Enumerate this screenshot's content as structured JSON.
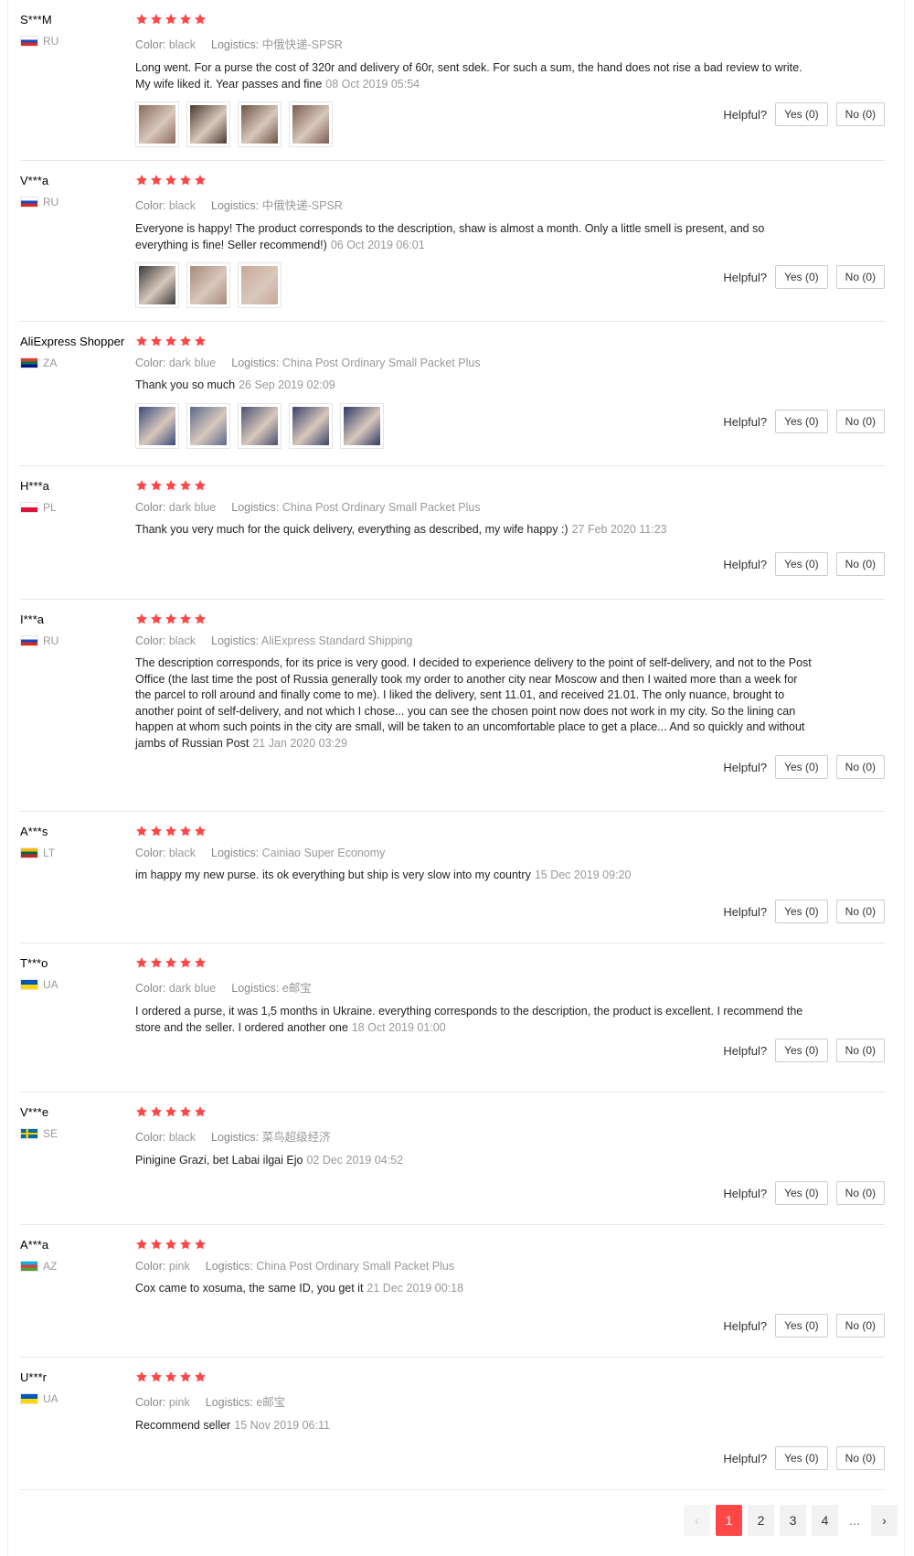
{
  "colors": {
    "star": "#ff4747",
    "accent": "#ff4747"
  },
  "labels": {
    "color": "Color:",
    "logistics": "Logistics:",
    "helpful": "Helpful?"
  },
  "reviews": [
    {
      "user": "S***M",
      "country": "RU",
      "flag": "ru",
      "rating": 5,
      "color": "black",
      "logistics": "中俄快递-SPSR",
      "text": "Long went. For a purse the cost of 320r and delivery of 60r, sent sdek. For such a sum, the hand does not rise a bad review to write. My wife liked it. Year passes and fine",
      "date": "08 Oct 2019 05:54",
      "photos": [
        "#8a6a5c",
        "#4a3a32",
        "#6b5444",
        "#7b5a50"
      ],
      "yes": "Yes (0)",
      "no": "No (0)"
    },
    {
      "user": "V***a",
      "country": "RU",
      "flag": "ru",
      "rating": 5,
      "color": "black",
      "logistics": "中俄快递-SPSR",
      "text": "Everyone is happy! The product corresponds to the description, shaw is almost a month. Only a little smell is present, and so everything is fine! Seller recommend!)",
      "date": "06 Oct 2019 06:01",
      "photos": [
        "#3a3a3a",
        "#a88a7a",
        "#c9a898"
      ],
      "yes": "Yes (0)",
      "no": "No (0)"
    },
    {
      "user": "AliExpress Shopper",
      "country": "ZA",
      "flag": "za",
      "rating": 5,
      "color": "dark blue",
      "logistics": "China Post Ordinary Small Packet Plus",
      "text": "Thank you so much",
      "date": "26 Sep 2019 02:09",
      "photos": [
        "#3b4a7a",
        "#5a6a8a",
        "#4a5070",
        "#3a4468",
        "#2e3a66"
      ],
      "yes": "Yes (0)",
      "no": "No (0)"
    },
    {
      "user": "H***a",
      "country": "PL",
      "flag": "pl",
      "rating": 5,
      "color": "dark blue",
      "logistics": "China Post Ordinary Small Packet Plus",
      "text": "Thank you very much for the quick delivery, everything as described, my wife happy :)",
      "date": "27 Feb 2020 11:23",
      "photos": [],
      "yes": "Yes (0)",
      "no": "No (0)"
    },
    {
      "user": "I***a",
      "country": "RU",
      "flag": "ru",
      "rating": 5,
      "color": "black",
      "logistics": "AliExpress Standard Shipping",
      "text": "The description corresponds, for its price is very good. I decided to experience delivery to the point of self-delivery, and not to the Post Office (the last time the post of Russia generally took my order to another city near Moscow and then I waited more than a week for the parcel to roll around and finally come to me). I liked the delivery, sent 11.01, and received 21.01. The only nuance, brought to another point of self-delivery, and not which I chose... you can see the chosen point now does not work in my city. So the lining can happen at whom such points in the city are small, will be taken to an uncomfortable place to get a place... And so quickly and without jambs of Russian Post",
      "date": "21 Jan 2020 03:29",
      "photos": [],
      "yes": "Yes (0)",
      "no": "No (0)"
    },
    {
      "user": "A***s",
      "country": "LT",
      "flag": "lt",
      "rating": 5,
      "color": "black",
      "logistics": "Cainiao Super Economy",
      "text": "im happy my new purse. its ok everything but ship is very slow into my country",
      "date": "15 Dec 2019 09:20",
      "photos": [],
      "yes": "Yes (0)",
      "no": "No (0)"
    },
    {
      "user": "T***o",
      "country": "UA",
      "flag": "ua",
      "rating": 5,
      "color": "dark blue",
      "logistics": "e邮宝",
      "text": "I ordered a purse, it was 1,5 months in Ukraine. everything corresponds to the description, the product is excellent. I recommend the store and the seller. I ordered another one",
      "date": "18 Oct 2019 01:00",
      "photos": [],
      "yes": "Yes (0)",
      "no": "No (0)"
    },
    {
      "user": "V***e",
      "country": "SE",
      "flag": "se",
      "rating": 5,
      "color": "black",
      "logistics": "菜鸟超级经济",
      "text": "Pinigine Grazi, bet Labai ilgai Ejo",
      "date": "02 Dec 2019 04:52",
      "photos": [],
      "yes": "Yes (0)",
      "no": "No (0)"
    },
    {
      "user": "A***a",
      "country": "AZ",
      "flag": "az",
      "rating": 5,
      "color": "pink",
      "logistics": "China Post Ordinary Small Packet Plus",
      "text": "Cox came to xosuma, the same ID, you get it",
      "date": "21 Dec 2019 00:18",
      "photos": [],
      "yes": "Yes (0)",
      "no": "No (0)"
    },
    {
      "user": "U***r",
      "country": "UA",
      "flag": "ua",
      "rating": 5,
      "color": "pink",
      "logistics": "e邮宝",
      "text": "Recommend seller",
      "date": "15 Nov 2019 06:11",
      "photos": [],
      "yes": "Yes (0)",
      "no": "No (0)"
    }
  ],
  "pagination": {
    "prev_icon": "chevron-left-icon",
    "next_icon": "chevron-right-icon",
    "pages": [
      "1",
      "2",
      "3",
      "4"
    ],
    "current": "1",
    "ellipsis": "...",
    "prev": "‹",
    "next": "›"
  }
}
